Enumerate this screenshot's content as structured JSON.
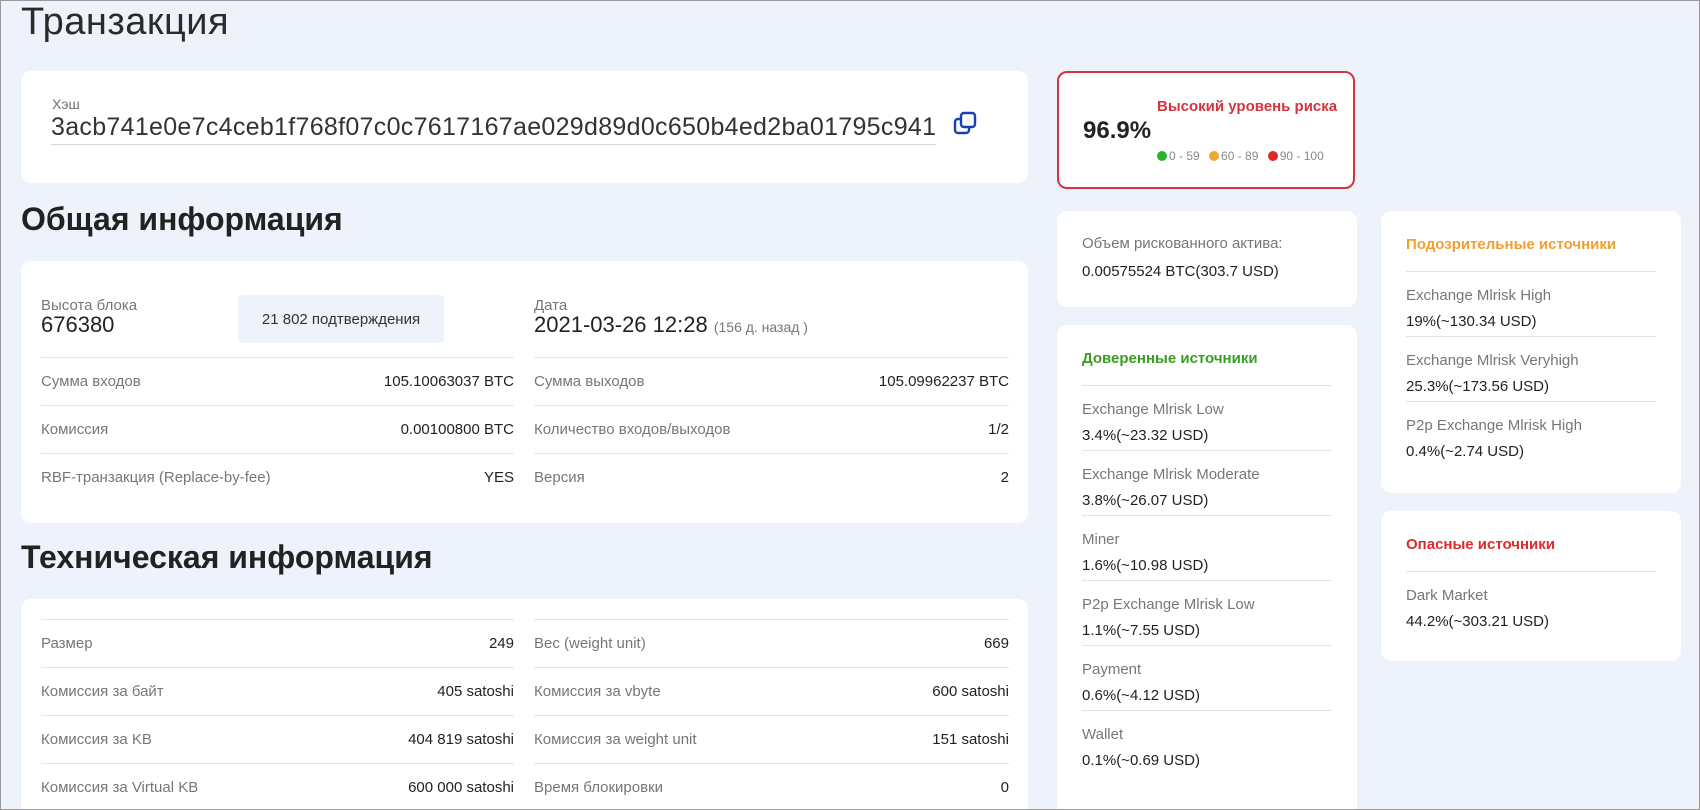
{
  "page": {
    "title": "Транзакция"
  },
  "hash": {
    "label": "Хэш",
    "value": "3acb741e0e7c4ceb1f768f07c0c7617167ae029d89d0c650b4ed2ba01795c941"
  },
  "risk": {
    "percent": "96.9%",
    "level": "Высокий уровень риска",
    "legend": [
      "0 - 59",
      "60 - 89",
      "90 - 100"
    ],
    "colors": {
      "low": "#2bb32b",
      "medium": "#f0a830",
      "high": "#e02a2a"
    }
  },
  "general": {
    "title": "Общая информация",
    "block_height_label": "Высота блока",
    "block_height_value": "676380",
    "confirmations": "21 802 подтверждения",
    "date_label": "Дата",
    "date_value": "2021-03-26 12:28",
    "date_ago": "(156 д. назад )",
    "rows": [
      {
        "left_label": "Сумма входов",
        "left_value": "105.10063037 BTC",
        "right_label": "Сумма выходов",
        "right_value": "105.09962237 BTC"
      },
      {
        "left_label": "Комиссия",
        "left_value": "0.00100800 BTC",
        "right_label": "Количество входов/выходов",
        "right_value": "1/2"
      },
      {
        "left_label": "RBF-транзакция (Replace-by-fee)",
        "left_value": "YES",
        "right_label": "Версия",
        "right_value": "2"
      }
    ]
  },
  "technical": {
    "title": "Техническая информация",
    "rows": [
      {
        "left_label": "Размер",
        "left_value": "249",
        "right_label": "Вес (weight unit)",
        "right_value": "669"
      },
      {
        "left_label": "Комиссия за байт",
        "left_value": "405 satoshi",
        "right_label": "Комиссия за vbyte",
        "right_value": "600 satoshi"
      },
      {
        "left_label": "Комиссия за KB",
        "left_value": "404 819 satoshi",
        "right_label": "Комиссия за weight unit",
        "right_value": "151 satoshi"
      },
      {
        "left_label": "Комиссия за Virtual KB",
        "left_value": "600 000 satoshi",
        "right_label": "Время блокировки",
        "right_value": "0"
      }
    ]
  },
  "risk_volume": {
    "label": "Объем рискованного актива:",
    "value": "0.00575524 BTC(303.7 USD)"
  },
  "trusted": {
    "title": "Доверенные источники",
    "color": "#3a9d23",
    "items": [
      {
        "name": "Exchange Mlrisk Low",
        "value": "3.4%(~23.32 USD)"
      },
      {
        "name": "Exchange Mlrisk Moderate",
        "value": "3.8%(~26.07 USD)"
      },
      {
        "name": "Miner",
        "value": "1.6%(~10.98 USD)"
      },
      {
        "name": "P2p Exchange Mlrisk Low",
        "value": "1.1%(~7.55 USD)"
      },
      {
        "name": "Payment",
        "value": "0.6%(~4.12 USD)"
      },
      {
        "name": "Wallet",
        "value": "0.1%(~0.69 USD)"
      }
    ]
  },
  "suspicious": {
    "title": "Подозрительные источники",
    "color": "#f0a030",
    "items": [
      {
        "name": "Exchange Mlrisk High",
        "value": "19%(~130.34 USD)"
      },
      {
        "name": "Exchange Mlrisk Veryhigh",
        "value": "25.3%(~173.56 USD)"
      },
      {
        "name": "P2p Exchange Mlrisk High",
        "value": "0.4%(~2.74 USD)"
      }
    ]
  },
  "dangerous": {
    "title": "Опасные источники",
    "color": "#e02a2a",
    "items": [
      {
        "name": "Dark Market",
        "value": "44.2%(~303.21 USD)"
      }
    ]
  }
}
